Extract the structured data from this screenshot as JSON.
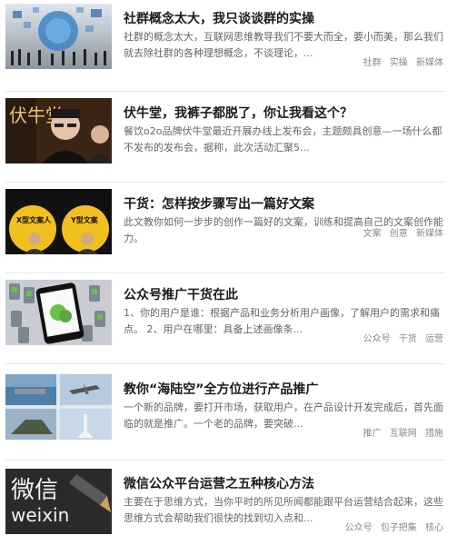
{
  "articles": [
    {
      "title": "社群概念太大，我只谈谈群的实操",
      "desc": "社群的概念太大，互联网思维教导我们不要大而全，要小而美，那么我们就去除社群的各种理想概念，不谈理论，...",
      "tags": [
        "社群",
        "实操",
        "新媒体"
      ],
      "thumb_icon": "crowd-network-image"
    },
    {
      "title": "伏牛堂，我裤子都脱了，你让我看这个？",
      "desc": "餐饮o2o品牌伏牛堂最近开展办线上发布会，主题颇具创意—一场什么都不发布的发布会，据称，此次活动汇聚5...",
      "tags": [],
      "thumb_icon": "founder-portrait-image",
      "thumb_text": "伏牛堂"
    },
    {
      "title": "干货：怎样按步骤写出一篇好文案",
      "desc": "此文教你如何一步步的创作一篇好的文案，训练和提高自己的文案创作能力。",
      "tags": [
        "文案",
        "创意",
        "新媒体"
      ],
      "thumb_icon": "copywriter-comparison-image",
      "thumb_labels": [
        "X型文案人",
        "Y型文案"
      ]
    },
    {
      "title": "公众号推广干货在此",
      "desc": "1、你的用户是谁：根据产品和业务分析用户画像，了解用户的需求和痛点。 2、用户在哪里：具备上述画像条...",
      "tags": [
        "公众号",
        "干货",
        "运营"
      ],
      "thumb_icon": "wechat-phone-image"
    },
    {
      "title": "教你“海陆空”全方位进行产品推广",
      "desc": "一个新的品牌，要打开市场，获取用户，在产品设计开发完成后，首先面临的就是推广。一个老的品牌，要突破...",
      "tags": [
        "推广",
        "互联网",
        "措施"
      ],
      "thumb_icon": "sea-land-air-image"
    },
    {
      "title": "微信公众平台运营之五种核心方法",
      "desc": "主要在于思维方式，当你平时的所见所闻都能跟平台运营结合起来，这些思维方式会帮助我们很快的找到切入点和...",
      "tags": [
        "公众号",
        "包子把集",
        "核心"
      ],
      "thumb_icon": "weixin-logo-image",
      "thumb_text": "微信",
      "thumb_sub": "weixin"
    }
  ],
  "colors": {
    "title": "#1a1a1a",
    "desc": "#666666",
    "tag": "#888888",
    "separator": "#e6e6e6"
  }
}
